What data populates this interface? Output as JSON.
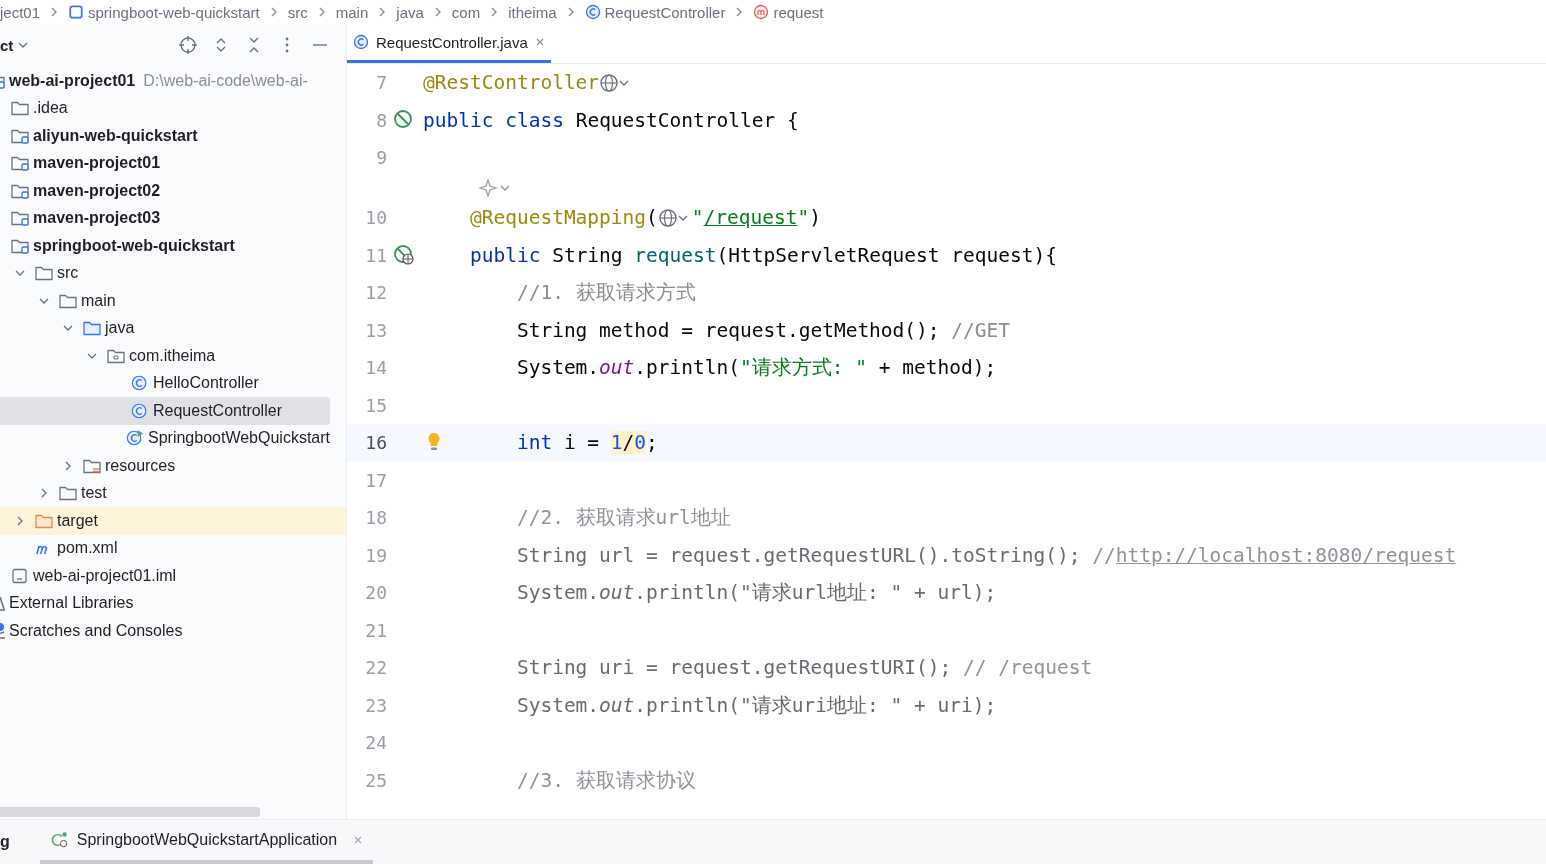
{
  "breadcrumbs": [
    {
      "label": "ject01",
      "kind": "plain"
    },
    {
      "label": "springboot-web-quickstart",
      "kind": "module"
    },
    {
      "label": "src",
      "kind": "plain"
    },
    {
      "label": "main",
      "kind": "plain"
    },
    {
      "label": "java",
      "kind": "plain"
    },
    {
      "label": "com",
      "kind": "plain"
    },
    {
      "label": "itheima",
      "kind": "plain"
    },
    {
      "label": "RequestController",
      "kind": "class"
    },
    {
      "label": "request",
      "kind": "method"
    }
  ],
  "project_panel": {
    "title": "ct",
    "tree": [
      {
        "label": "web-ai-project01",
        "hint": "D:\\web-ai-code\\web-ai-",
        "kind": "module",
        "bold": true,
        "selected": false,
        "excluded": false,
        "children": [
          {
            "label": ".idea",
            "kind": "folder",
            "bold": false,
            "selected": false,
            "excluded": false
          },
          {
            "label": "aliyun-web-quickstart",
            "kind": "module",
            "bold": true,
            "selected": false,
            "excluded": false
          },
          {
            "label": "maven-project01",
            "kind": "module",
            "bold": true,
            "selected": false,
            "excluded": false
          },
          {
            "label": "maven-project02",
            "kind": "module",
            "bold": true,
            "selected": false,
            "excluded": false
          },
          {
            "label": "maven-project03",
            "kind": "module",
            "bold": true,
            "selected": false,
            "excluded": false
          },
          {
            "label": "springboot-web-quickstart",
            "kind": "module",
            "bold": true,
            "selected": false,
            "excluded": false,
            "children": [
              {
                "label": "src",
                "kind": "folder",
                "bold": false,
                "selected": false,
                "excluded": false,
                "expanded": true,
                "children": [
                  {
                    "label": "main",
                    "kind": "folder",
                    "bold": false,
                    "selected": false,
                    "excluded": false,
                    "expanded": true,
                    "children": [
                      {
                        "label": "java",
                        "kind": "source-folder",
                        "bold": false,
                        "selected": false,
                        "excluded": false,
                        "expanded": true,
                        "children": [
                          {
                            "label": "com.itheima",
                            "kind": "package",
                            "bold": false,
                            "selected": false,
                            "excluded": false,
                            "expanded": true,
                            "children": [
                              {
                                "label": "HelloController",
                                "kind": "class",
                                "bold": false,
                                "selected": false,
                                "excluded": false
                              },
                              {
                                "label": "RequestController",
                                "kind": "class",
                                "bold": false,
                                "selected": true,
                                "excluded": false
                              },
                              {
                                "label": "SpringbootWebQuickstart",
                                "kind": "app-class",
                                "bold": false,
                                "selected": false,
                                "excluded": false
                              }
                            ]
                          }
                        ]
                      },
                      {
                        "label": "resources",
                        "kind": "resource-folder",
                        "bold": false,
                        "selected": false,
                        "excluded": false,
                        "expanded": false
                      }
                    ]
                  },
                  {
                    "label": "test",
                    "kind": "folder",
                    "bold": false,
                    "selected": false,
                    "excluded": false,
                    "expanded": false
                  }
                ]
              },
              {
                "label": "target",
                "kind": "folder",
                "bold": false,
                "selected": false,
                "excluded": true,
                "expanded": false
              },
              {
                "label": "pom.xml",
                "kind": "maven",
                "bold": false,
                "selected": false,
                "excluded": false
              }
            ]
          },
          {
            "label": "web-ai-project01.iml",
            "kind": "file",
            "bold": false,
            "selected": false,
            "excluded": false
          }
        ]
      },
      {
        "label": "External Libraries",
        "kind": "libraries",
        "bold": false,
        "selected": false,
        "excluded": false
      },
      {
        "label": "Scratches and Consoles",
        "kind": "scratches",
        "bold": false,
        "selected": false,
        "excluded": false
      }
    ]
  },
  "editor": {
    "tabs": [
      {
        "label": "RequestController.java",
        "selected": true
      }
    ],
    "lines": [
      {
        "kind": "code",
        "number": "7",
        "current": false,
        "dimmed": false,
        "tokens": [
          {
            "text": "@RestController",
            "kind": "ann"
          },
          {
            "kind": "globe"
          }
        ]
      },
      {
        "kind": "code",
        "number": "8",
        "gutter": {
          "kind": "bean"
        },
        "current": false,
        "dimmed": false,
        "tokens": [
          {
            "text": "public",
            "kind": "kw"
          },
          {
            "text": " class",
            "kind": "kw"
          },
          {
            "text": " RequestController {",
            "kind": "plain"
          }
        ]
      },
      {
        "kind": "code",
        "number": "9",
        "current": false
      },
      {
        "kind": "inlay"
      },
      {
        "kind": "code",
        "number": "10",
        "current": false,
        "dimmed": false,
        "tokens": [
          {
            "text": "    @RequestMapping",
            "kind": "ann"
          },
          {
            "text": "(",
            "kind": "plain"
          },
          {
            "kind": "globe"
          },
          {
            "text": "\"",
            "kind": "str"
          },
          {
            "text": "/request",
            "kind": "strlink"
          },
          {
            "text": "\"",
            "kind": "str"
          },
          {
            "text": ")",
            "kind": "plain"
          }
        ]
      },
      {
        "kind": "code",
        "number": "11",
        "gutter": {
          "kind": "endpoint"
        },
        "current": false,
        "dimmed": false,
        "tokens": [
          {
            "text": "    public",
            "kind": "kw"
          },
          {
            "text": " String ",
            "kind": "plain"
          },
          {
            "text": "request",
            "kind": "method"
          },
          {
            "text": "(HttpServletRequest request){",
            "kind": "plain"
          }
        ]
      },
      {
        "kind": "code",
        "number": "12",
        "current": false,
        "dimmed": false,
        "tokens": [
          {
            "text": "        //1. 获取请求方式",
            "kind": "comment"
          }
        ]
      },
      {
        "kind": "code",
        "number": "13",
        "current": false,
        "dimmed": false,
        "tokens": [
          {
            "text": "        String method = request.getMethod(); ",
            "kind": "plain"
          },
          {
            "text": "//GET",
            "kind": "comment"
          }
        ]
      },
      {
        "kind": "code",
        "number": "14",
        "current": false,
        "dimmed": false,
        "tokens": [
          {
            "text": "        System.",
            "kind": "plain"
          },
          {
            "text": "out",
            "kind": "field"
          },
          {
            "text": ".println(",
            "kind": "plain"
          },
          {
            "text": "\"请求方式: \"",
            "kind": "str"
          },
          {
            "text": " + method);",
            "kind": "plain"
          }
        ]
      },
      {
        "kind": "code",
        "number": "15",
        "current": false
      },
      {
        "kind": "code",
        "number": "16",
        "gutter": {
          "kind": "bulb"
        },
        "current": true,
        "dimmed": false,
        "tokens": [
          {
            "text": "        int",
            "kind": "kw"
          },
          {
            "text": " i = ",
            "kind": "plain"
          },
          {
            "text": "1",
            "kind": "numwarn"
          },
          {
            "text": "/",
            "kind": "plainwarn"
          },
          {
            "text": "0",
            "kind": "numwarn"
          },
          {
            "text": ";",
            "kind": "plain"
          }
        ]
      },
      {
        "kind": "code",
        "number": "17",
        "current": false
      },
      {
        "kind": "code",
        "number": "18",
        "current": false,
        "dimmed": true,
        "tokens": [
          {
            "text": "        //2. 获取请求url地址",
            "kind": "comment"
          }
        ]
      },
      {
        "kind": "code",
        "number": "19",
        "current": false,
        "dimmed": true,
        "tokens": [
          {
            "text": "        String url = request.getRequestURL().toString(); ",
            "kind": "plain"
          },
          {
            "text": "//",
            "kind": "comment"
          },
          {
            "text": "http://localhost:8080/request",
            "kind": "link"
          }
        ]
      },
      {
        "kind": "code",
        "number": "20",
        "current": false,
        "dimmed": true,
        "tokens": [
          {
            "text": "        System.",
            "kind": "plain"
          },
          {
            "text": "out",
            "kind": "field"
          },
          {
            "text": ".println(",
            "kind": "plain"
          },
          {
            "text": "\"请求url地址: \"",
            "kind": "str"
          },
          {
            "text": " + url);",
            "kind": "plain"
          }
        ]
      },
      {
        "kind": "code",
        "number": "21",
        "current": false
      },
      {
        "kind": "code",
        "number": "22",
        "current": false,
        "dimmed": true,
        "tokens": [
          {
            "text": "        String uri = request.getRequestURI(); ",
            "kind": "plain"
          },
          {
            "text": "// /request",
            "kind": "comment"
          }
        ]
      },
      {
        "kind": "code",
        "number": "23",
        "current": false,
        "dimmed": true,
        "tokens": [
          {
            "text": "        System.",
            "kind": "plain"
          },
          {
            "text": "out",
            "kind": "field"
          },
          {
            "text": ".println(",
            "kind": "plain"
          },
          {
            "text": "\"请求uri地址: \"",
            "kind": "str"
          },
          {
            "text": " + uri);",
            "kind": "plain"
          }
        ]
      },
      {
        "kind": "code",
        "number": "24",
        "current": false
      },
      {
        "kind": "code",
        "number": "25",
        "current": false,
        "dimmed": true,
        "tokens": [
          {
            "text": "        //3. 获取请求协议",
            "kind": "comment"
          }
        ]
      }
    ]
  },
  "bottom_bar": {
    "label": "g",
    "tabs": [
      {
        "label": "SpringbootWebQuickstartApplication",
        "selected": true
      }
    ]
  }
}
